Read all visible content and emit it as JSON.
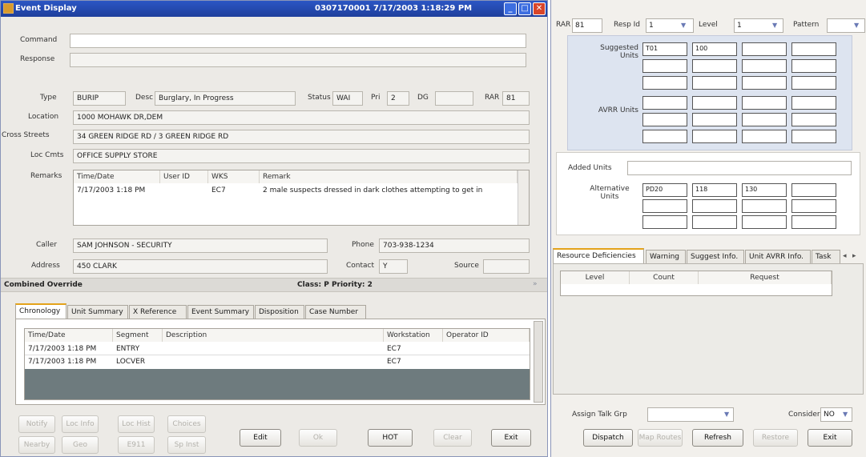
{
  "window": {
    "title": "Event Display",
    "titlebar_info": "0307170001 7/17/2003 1:18:29 PM"
  },
  "command": {
    "label": "Command",
    "value": ""
  },
  "response": {
    "label": "Response",
    "value": ""
  },
  "event": {
    "type_label": "Type",
    "type": "BURIP",
    "desc_label": "Desc",
    "desc": "Burglary, In Progress",
    "status_label": "Status",
    "status": "WAI",
    "pri_label": "Pri",
    "pri": "2",
    "dg_label": "DG",
    "dg": "",
    "rar_label": "RAR",
    "rar": "81",
    "location_label": "Location",
    "location": "1000 MOHAWK DR,DEM",
    "cross_label": "Cross Streets",
    "cross": "34 GREEN RIDGE RD / 3 GREEN RIDGE RD",
    "loccmts_label": "Loc Cmts",
    "loccmts": "OFFICE SUPPLY STORE",
    "remarks_label": "Remarks"
  },
  "remarks": {
    "headers": [
      "Time/Date",
      "User ID",
      "WKS",
      "Remark"
    ],
    "rows": [
      {
        "time": "7/17/2003 1:18 PM",
        "user": "",
        "wks": "EC7",
        "remark": "2 male suspects dressed in dark clothes attempting to get in"
      }
    ]
  },
  "caller": {
    "caller_label": "Caller",
    "caller": "SAM JOHNSON - SECURITY",
    "phone_label": "Phone",
    "phone": "703-938-1234",
    "address_label": "Address",
    "address": "450 CLARK",
    "contact_label": "Contact",
    "contact": "Y",
    "source_label": "Source",
    "source": ""
  },
  "override": {
    "label": "Combined Override",
    "class_priority": "Class: P Priority: 2"
  },
  "tabs": [
    "Chronology",
    "Unit Summary",
    "X Reference",
    "Event Summary",
    "Disposition",
    "Case Number"
  ],
  "chronology": {
    "headers": [
      "Time/Date",
      "Segment",
      "Description",
      "Workstation",
      "Operator ID"
    ],
    "rows": [
      {
        "time": "7/17/2003 1:18 PM",
        "segment": "ENTRY",
        "desc": "",
        "ws": "EC7",
        "op": ""
      },
      {
        "time": "7/17/2003 1:18 PM",
        "segment": "LOCVER",
        "desc": "",
        "ws": "EC7",
        "op": ""
      }
    ]
  },
  "bottom_buttons": {
    "notify": "Notify",
    "loc_info": "Loc Info",
    "loc_hist": "Loc Hist",
    "choices": "Choices",
    "nearby": "Nearby",
    "geo": "Geo",
    "e911": "E911",
    "sp_inst": "Sp Inst",
    "edit": "Edit",
    "ok": "Ok",
    "hot": "HOT",
    "clear": "Clear",
    "exit": "Exit"
  },
  "right": {
    "rar_label": "RAR",
    "rar": "81",
    "resp_label": "Resp Id",
    "resp": "1",
    "level_label": "Level",
    "level": "1",
    "pattern_label": "Pattern",
    "pattern": "",
    "suggested_label": "Suggested Units",
    "suggested": [
      "T01",
      "100",
      "",
      "",
      "",
      "",
      "",
      "",
      "",
      "",
      "",
      ""
    ],
    "avrr_label": "AVRR Units",
    "avrr": [
      "",
      "",
      "",
      "",
      "",
      "",
      "",
      "",
      "",
      "",
      "",
      ""
    ],
    "added_label": "Added Units",
    "added": "",
    "alt_label": "Alternative Units",
    "alt": [
      "PD20",
      "118",
      "130",
      "",
      "",
      "",
      "",
      "",
      "",
      "",
      "",
      ""
    ],
    "tabs": [
      "Resource Deficiencies",
      "Warning",
      "Suggest Info.",
      "Unit AVRR Info.",
      "Task"
    ],
    "def_headers": [
      "Level",
      "Count",
      "Request"
    ],
    "assign_label": "Assign Talk Grp",
    "assign": "",
    "consider_label": "Consider",
    "consider": "NO",
    "buttons": {
      "dispatch": "Dispatch",
      "map_routes": "Map Routes",
      "refresh": "Refresh",
      "restore": "Restore",
      "exit": "Exit"
    }
  },
  "colors": {
    "titlebar": "#2b56c4",
    "tab_accent": "#e3a21a",
    "units_panel": "#dde4f0"
  }
}
